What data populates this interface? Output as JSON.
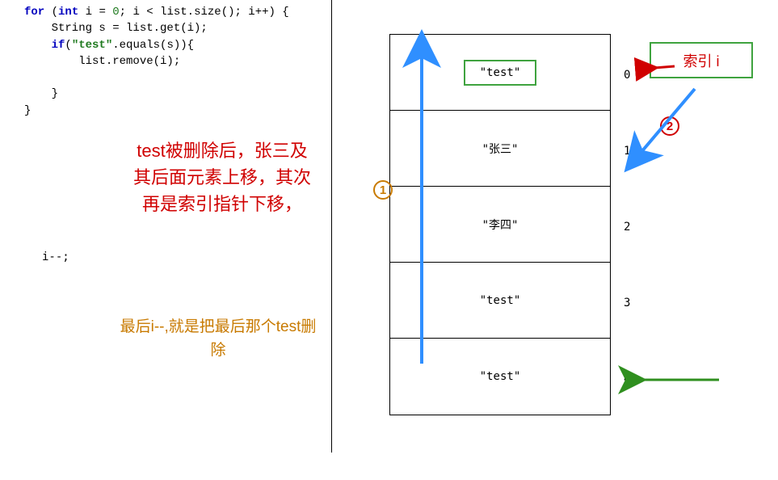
{
  "code": {
    "line1_for": "for",
    "line1_int": "int",
    "line1_rest1": " i = ",
    "line1_zero": "0",
    "line1_rest2": "; i < list.size(); i++) {",
    "line2": "    String s = list.get(i);",
    "line3_if": "if",
    "line3_paren": "(",
    "line3_str": "\"test\"",
    "line3_rest": ".equals(s)){",
    "line4": "        list.remove(i);",
    "line5": "    }",
    "line6": "}",
    "idec": "i--;"
  },
  "explain": {
    "red": "test被删除后，张三及其后面元素上移，其次再是索引指针下移，",
    "brown": "最后i--,就是把最后那个test删除"
  },
  "list": [
    {
      "value": "\"test\"",
      "outlined": true
    },
    {
      "value": "\"张三\"",
      "outlined": false
    },
    {
      "value": "\"李四\"",
      "outlined": false
    },
    {
      "value": "\"test\"",
      "outlined": false
    },
    {
      "value": "\"test\"",
      "outlined": false
    }
  ],
  "indices": [
    "0",
    "1",
    "2",
    "3",
    "4"
  ],
  "index_label": "索引 i",
  "circled": {
    "one": "1",
    "two": "2"
  },
  "colors": {
    "red": "#d00000",
    "green_border": "#3fa33f",
    "brown": "#c87a00",
    "blue_arrow": "#2f8fff",
    "green_arrow": "#2f8f1f"
  }
}
